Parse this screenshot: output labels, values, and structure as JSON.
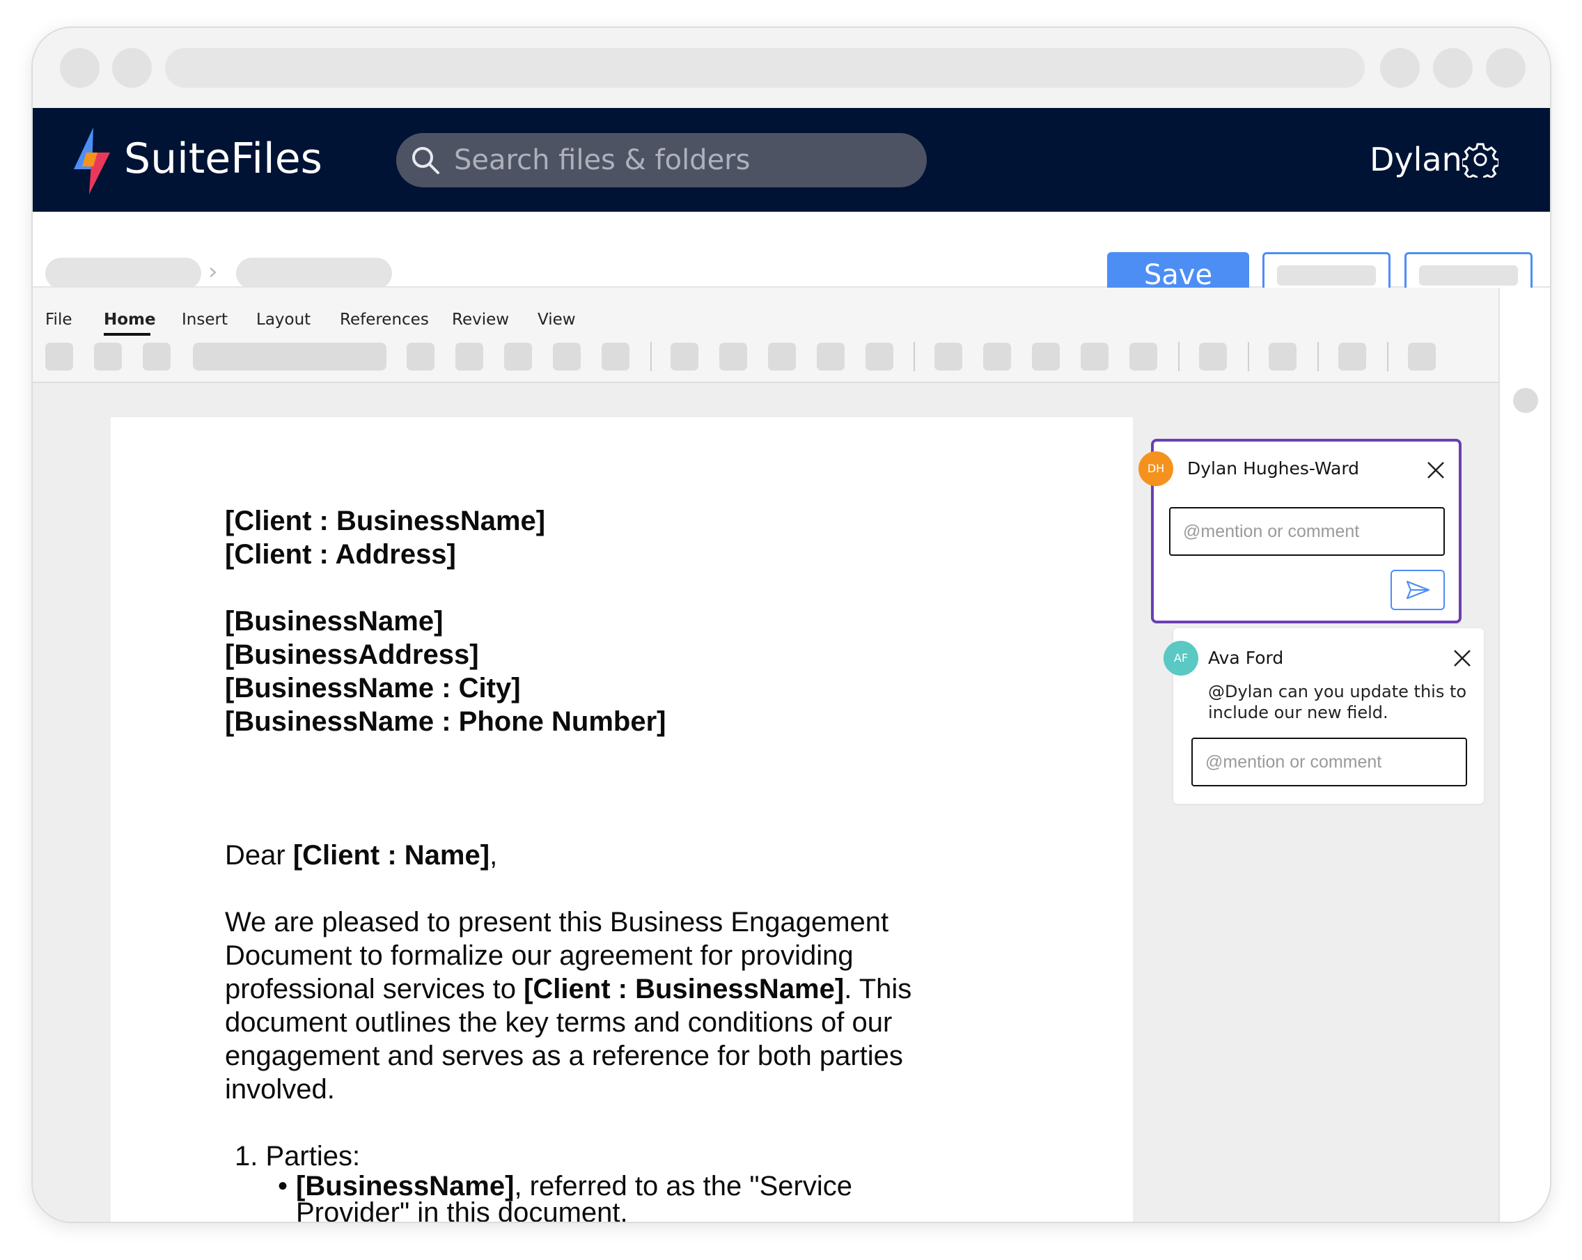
{
  "app": {
    "name": "SuiteFiles",
    "search_placeholder": "Search files & folders",
    "user_name": "Dylan",
    "brand_colors": {
      "navy": "#001334",
      "blue": "#4d8ef5",
      "purple": "#6a3fb2",
      "orange": "#f5921e",
      "teal": "#5ac8c3",
      "red": "#e8395a"
    }
  },
  "toolbar": {
    "save_label": "Save"
  },
  "ribbon": {
    "tabs": [
      "File",
      "Home",
      "Insert",
      "Layout",
      "References",
      "Review",
      "View"
    ],
    "active_tab": "Home"
  },
  "document": {
    "header_lines": [
      "[Client : BusinessName]",
      "[Client : Address]"
    ],
    "business_lines": [
      "[BusinessName]",
      "[BusinessAddress]",
      "[BusinessName : City]",
      "[BusinessName : Phone Number]"
    ],
    "greeting": {
      "prefix": "Dear ",
      "field": "[Client : Name]",
      "suffix": ","
    },
    "paragraph": {
      "part1": "We are pleased to present this Business Engagement Document to formalize our agreement for providing professional services to ",
      "field": "[Client : BusinessName]",
      "part2": ". This document outlines the key terms and conditions of our engagement and serves as a reference for both parties involved."
    },
    "list_item_1": {
      "number": "1.",
      "label": "Parties:"
    },
    "bullet_1": {
      "field": "[BusinessName]",
      "text": ", referred to as the \"Service Provider\" in this document."
    }
  },
  "comments": [
    {
      "initials": "DH",
      "author": "Dylan Hughes-Ward",
      "avatar_color": "#f5921e",
      "input_placeholder": "@mention or comment"
    },
    {
      "initials": "AF",
      "author": "Ava Ford",
      "avatar_color": "#5ac8c3",
      "text": "@Dylan can you update this to include our new field.",
      "input_placeholder": "@mention or comment"
    }
  ]
}
